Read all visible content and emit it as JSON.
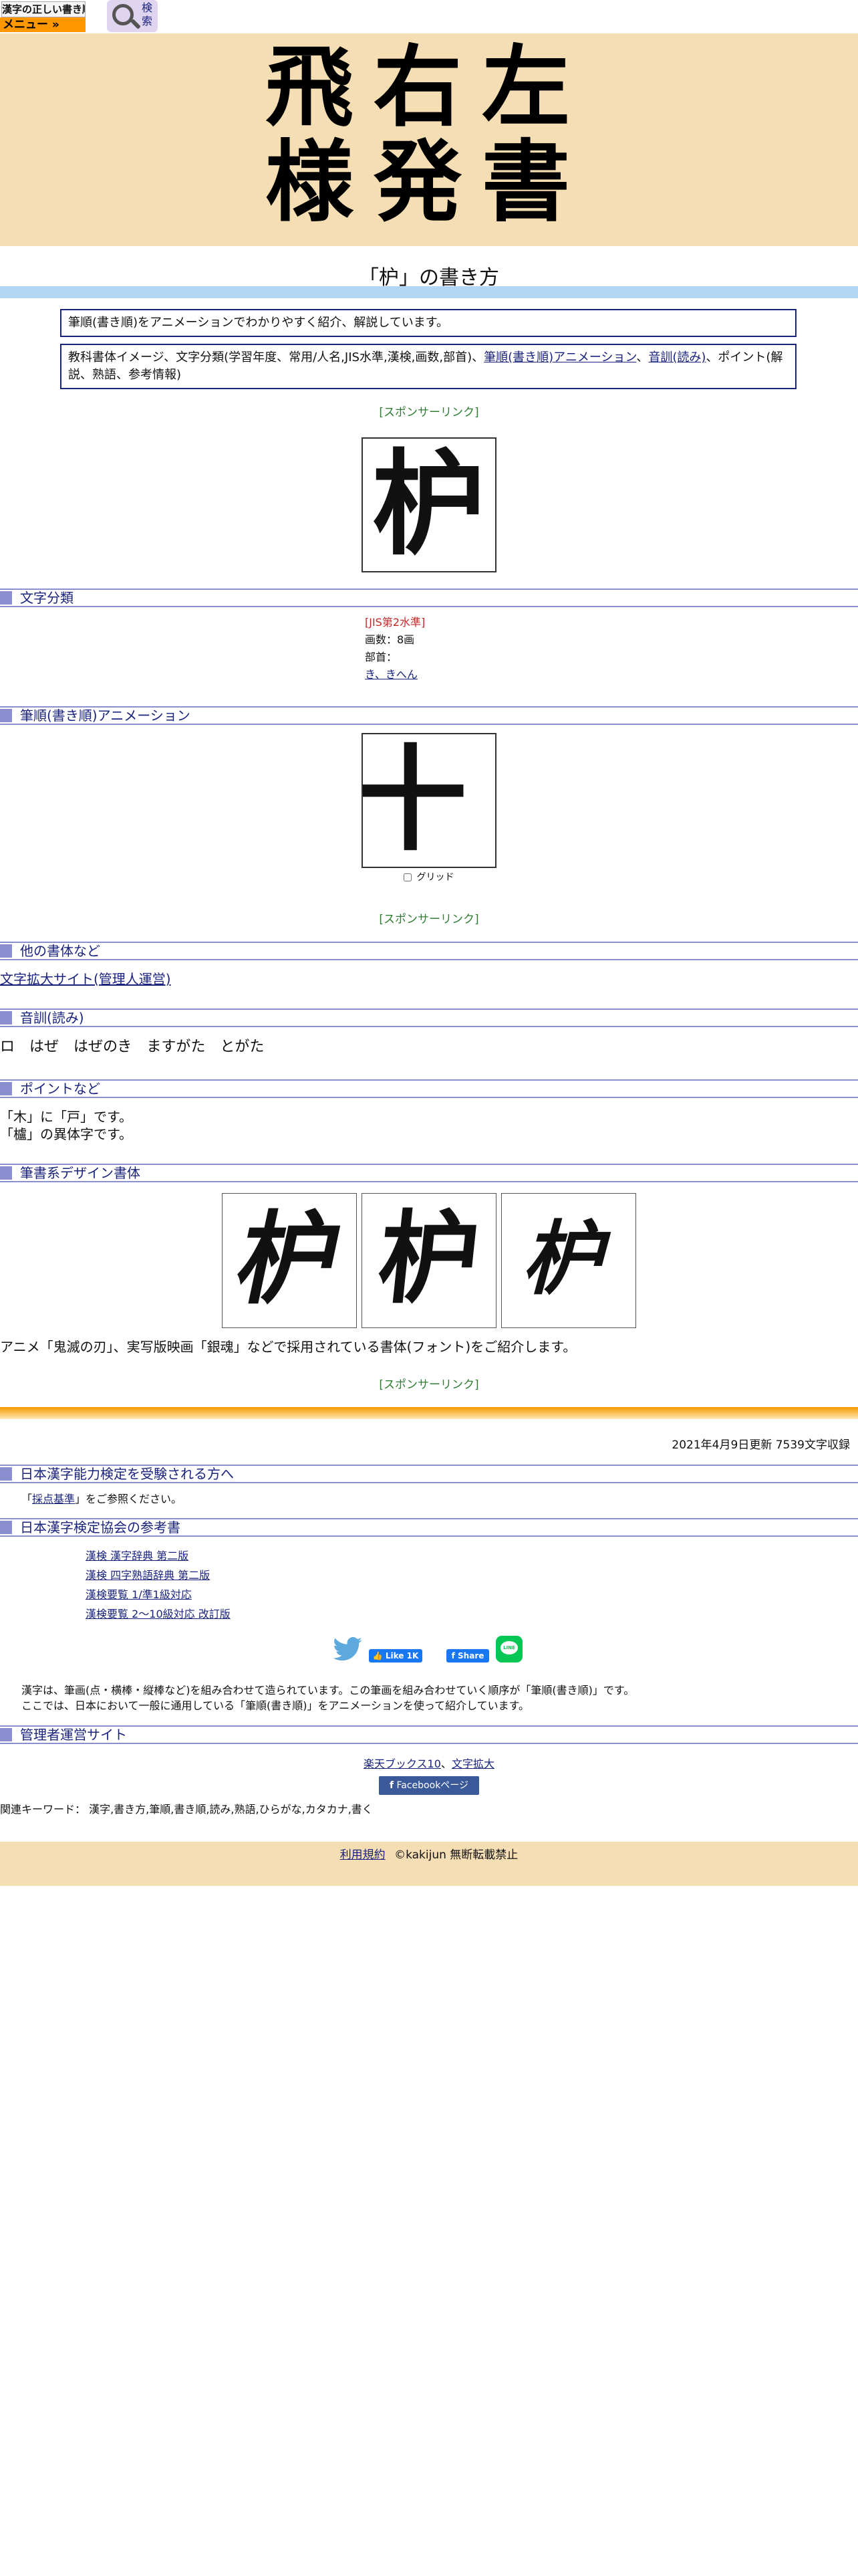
{
  "header": {
    "logo_text": "漢字の正しい書き順(筆順)",
    "menu_label": "メニュー »",
    "search_label": "検索",
    "hero_title": "飛右左様発書"
  },
  "page": {
    "title": "「枦」の書き方",
    "intro": "筆順(書き順)をアニメーションでわかりやすく紹介、解説しています。",
    "contents_prefix": "教科書体イメージ、文字分類(学習年度、常用/人名,JIS水準,漢検,画数,部首)、",
    "contents_link1": "筆順(書き順)アニメーション",
    "contents_sep": "、",
    "contents_link2": "音訓(読み)",
    "contents_suffix": "、ポイント(解説、熟語、参考情報)",
    "sponsor": "[スポンサーリンク]",
    "kanji": "枦"
  },
  "classification": {
    "heading": "文字分類",
    "jis": "[JIS第2水準]",
    "strokes": "画数：8画",
    "radical_label": "部首：",
    "radical_link": "き、きへん"
  },
  "animation": {
    "heading": "筆順(書き順)アニメーション",
    "grid_label": "グリッド",
    "frame_glyph": "十"
  },
  "other_styles": {
    "heading": "他の書体など",
    "link": "文字拡大サイト(管理人運営)"
  },
  "readings": {
    "heading": "音訓(読み)",
    "text": "ロ　はぜ　はぜのき　ますがた　とがた"
  },
  "points": {
    "heading": "ポイントなど",
    "line1": "「木」に「戸」です。",
    "line2": "「櫨」の異体字です。"
  },
  "design": {
    "heading": "筆書系デザイン書体",
    "glyphs": [
      "枦",
      "枦",
      "枦"
    ],
    "caption": "アニメ「鬼滅の刃」、実写版映画「銀魂」などで採用されている書体(フォント)をご紹介します。"
  },
  "update": {
    "text": "2021年4月9日更新 7539文字収録"
  },
  "kanken": {
    "heading": "日本漢字能力検定を受験される方へ",
    "note_prefix": "「",
    "note_link": "採点基準",
    "note_suffix": "」をご参照ください。"
  },
  "references": {
    "heading": "日本漢字検定協会の参考書",
    "items": [
      "漢検 漢字辞典 第二版",
      "漢検 四字熟語辞典 第二版",
      "漢検要覧 1/準1級対応",
      "漢検要覧 2～10級対応 改訂版"
    ]
  },
  "social": {
    "like_label": "Like 1K",
    "share_label": "Share",
    "line_label": "LINE"
  },
  "about": {
    "line1": "漢字は、筆画(点・横棒・縦棒など)を組み合わせて造られています。この筆画を組み合わせていく順序が「筆順(書き順)」です。",
    "line2": "ここでは、日本において一般に通用している「筆順(書き順)」をアニメーションを使って紹介しています。"
  },
  "admin_sites": {
    "heading": "管理者運営サイト",
    "link1": "楽天ブックス10",
    "sep": "、",
    "link2": "文字拡大",
    "facebook": "Facebookページ"
  },
  "keywords": "関連キーワード： 漢字,書き方,筆順,書き順,読み,熟語,ひらがな,カタカナ,書く",
  "footer": {
    "terms": "利用規約",
    "copyright": "©kakijun 無断転載禁止"
  },
  "colors": {
    "hero_bg": "#f5deb3",
    "band_blue": "#b3d6f5",
    "section_accent": "#8c8fcf",
    "sponsor_green": "#2e7d32",
    "jis_red": "#c62828",
    "menu_orange": "#ff9800"
  }
}
